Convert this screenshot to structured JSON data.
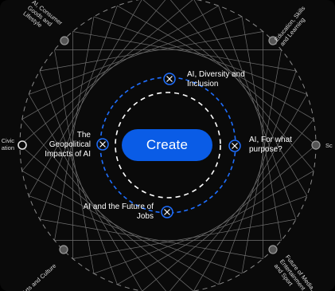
{
  "create_label": "Create",
  "inner_topics": [
    {
      "label": "AI, Diversity and Inclusion"
    },
    {
      "label": "AI, For what purpose?"
    },
    {
      "label": "AI and the Future of Jobs"
    },
    {
      "label": "The Geopolitical Impacts of AI"
    }
  ],
  "outer_topics": [
    {
      "label": "AI, Consumer Goods and Lifestyle",
      "lines": [
        "AI, Consumer",
        "Goods and",
        "Lifestyle"
      ]
    },
    {
      "label": "Education, Skills and Learning",
      "lines": [
        "Education, Skills",
        "and Learning"
      ]
    },
    {
      "label": "Sc",
      "lines": [
        "Sc"
      ]
    },
    {
      "label": "Future of Media, Entertainment and Sport",
      "lines": [
        "Future of Media,",
        "Entertainment",
        "and Sport"
      ]
    },
    {
      "label": "Arts and Culture",
      "lines": [
        "Arts and Culture"
      ]
    },
    {
      "label": "Civic ation",
      "lines": [
        "Civic",
        "ation"
      ]
    }
  ],
  "colors": {
    "accent": "#0a5ce6",
    "ring_blue": "#1f6fff",
    "node_outer": "#9a9a9a",
    "web_lines": "#6f6f6f",
    "background": "#0a0a0a"
  }
}
